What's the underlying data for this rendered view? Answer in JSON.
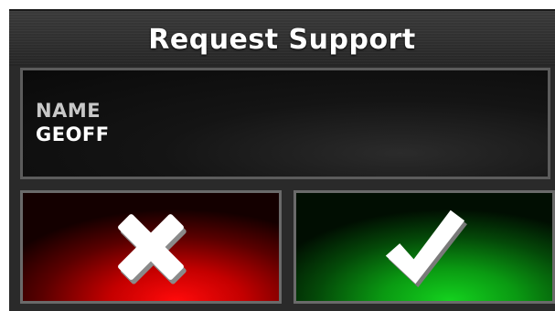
{
  "dialog": {
    "title": "Request Support"
  },
  "field": {
    "label": "NAME",
    "value": "GEOFF"
  },
  "buttons": {
    "cancel": {
      "icon": "close-icon",
      "color": "#e00000"
    },
    "confirm": {
      "icon": "checkmark-icon",
      "color": "#0fb81a"
    }
  }
}
